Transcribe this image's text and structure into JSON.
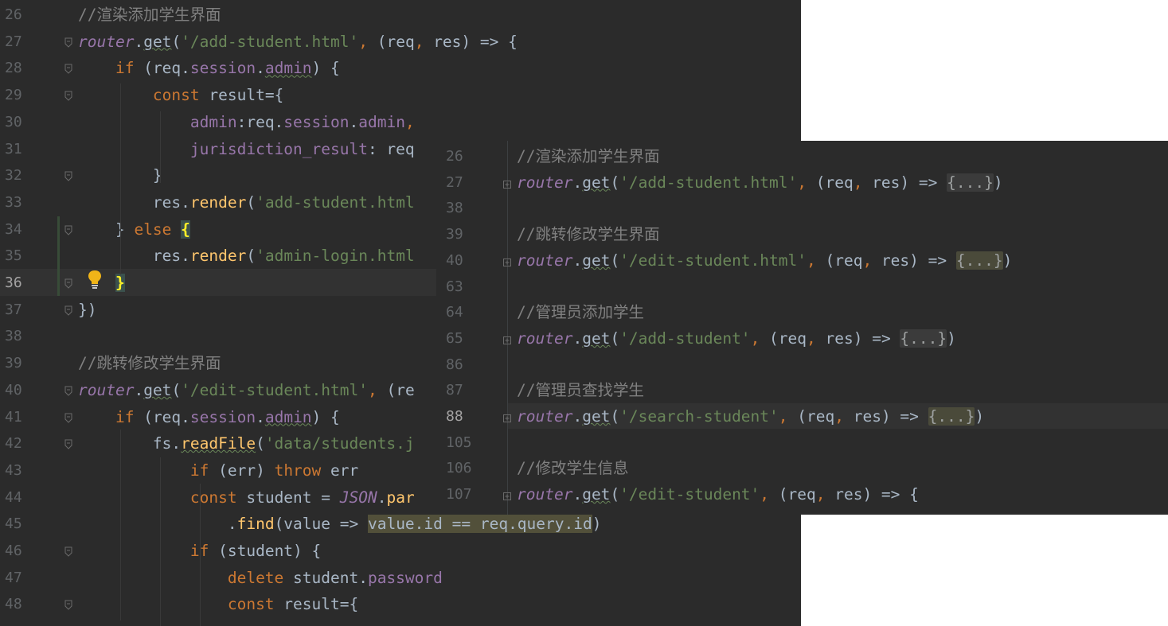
{
  "editor_main": {
    "line_numbers": [
      "26",
      "27",
      "28",
      "29",
      "30",
      "31",
      "32",
      "33",
      "34",
      "35",
      "36",
      "37",
      "38",
      "39",
      "40",
      "41",
      "42",
      "43",
      "44",
      "45",
      "46",
      "47",
      "48"
    ],
    "current_line": "36",
    "lines": [
      [
        [
          "cn",
          "//渲染添加学生界面"
        ]
      ],
      [
        [
          "obj",
          "router"
        ],
        [
          "",
          "."
        ],
        [
          "fn-w",
          "get"
        ],
        [
          "",
          "("
        ],
        [
          "str",
          "'/add-student.html'"
        ],
        [
          "kw",
          ", "
        ],
        [
          "",
          "(req"
        ],
        [
          "kw",
          ", "
        ],
        [
          "",
          "res) => {"
        ]
      ],
      [
        [
          "",
          "    "
        ],
        [
          "kw",
          "if "
        ],
        [
          "",
          "(req."
        ],
        [
          "prop",
          "session"
        ],
        [
          "",
          "."
        ],
        [
          "prop-w",
          "admin"
        ],
        [
          "",
          ") {"
        ]
      ],
      [
        [
          "",
          "        "
        ],
        [
          "kw",
          "const "
        ],
        [
          "",
          "result={"
        ]
      ],
      [
        [
          "",
          "            "
        ],
        [
          "prop",
          "admin"
        ],
        [
          "",
          ":req."
        ],
        [
          "prop",
          "session"
        ],
        [
          "",
          "."
        ],
        [
          "prop",
          "admin"
        ],
        [
          "kw",
          ","
        ]
      ],
      [
        [
          "",
          "            "
        ],
        [
          "prop",
          "jurisdiction_result"
        ],
        [
          "",
          ": req"
        ]
      ],
      [
        [
          "",
          "        }"
        ]
      ],
      [
        [
          "",
          "        res."
        ],
        [
          "fn",
          "render"
        ],
        [
          "",
          "("
        ],
        [
          "str",
          "'add-student.html"
        ]
      ],
      [
        [
          "",
          "    } "
        ],
        [
          "kw",
          "else "
        ],
        [
          "bh",
          "{"
        ]
      ],
      [
        [
          "",
          "        res."
        ],
        [
          "fn",
          "render"
        ],
        [
          "",
          "("
        ],
        [
          "str",
          "'admin-login.html"
        ]
      ],
      [
        [
          "",
          "    "
        ],
        [
          "bh",
          "}"
        ]
      ],
      [
        [
          "",
          "})"
        ]
      ],
      [],
      [
        [
          "cn",
          "//跳转修改学生界面"
        ]
      ],
      [
        [
          "obj",
          "router"
        ],
        [
          "",
          "."
        ],
        [
          "fn-w",
          "get"
        ],
        [
          "",
          "("
        ],
        [
          "str",
          "'/edit-student.html'"
        ],
        [
          "kw",
          ", "
        ],
        [
          "",
          "(re"
        ]
      ],
      [
        [
          "",
          "    "
        ],
        [
          "kw",
          "if "
        ],
        [
          "",
          "(req."
        ],
        [
          "prop",
          "session"
        ],
        [
          "",
          "."
        ],
        [
          "prop-w",
          "admin"
        ],
        [
          "",
          ") {"
        ]
      ],
      [
        [
          "",
          "        fs."
        ],
        [
          "fn-u",
          "readFile"
        ],
        [
          "",
          "("
        ],
        [
          "str",
          "'data/students.j"
        ]
      ],
      [
        [
          "",
          "            "
        ],
        [
          "kw",
          "if "
        ],
        [
          "",
          "(err) "
        ],
        [
          "kw",
          "throw "
        ],
        [
          "",
          "err"
        ]
      ],
      [
        [
          "",
          "            "
        ],
        [
          "kw",
          "const "
        ],
        [
          "",
          "student = "
        ],
        [
          "it",
          "JSON"
        ],
        [
          "",
          "."
        ],
        [
          "fn",
          "par"
        ]
      ],
      [
        [
          "",
          "                ."
        ],
        [
          "fn",
          "find"
        ],
        [
          "",
          "(value => "
        ],
        [
          "sel",
          "value.id == req.query.id"
        ],
        [
          "",
          ")"
        ]
      ],
      [
        [
          "",
          "            "
        ],
        [
          "kw",
          "if "
        ],
        [
          "",
          "(student) {"
        ]
      ],
      [
        [
          "",
          "                "
        ],
        [
          "kw",
          "delete "
        ],
        [
          "",
          "student."
        ],
        [
          "prop",
          "password"
        ]
      ],
      [
        [
          "",
          "                "
        ],
        [
          "kw",
          "const "
        ],
        [
          "",
          "result={"
        ]
      ]
    ]
  },
  "editor_popup": {
    "line_numbers": [
      "26",
      "27",
      "38",
      "39",
      "40",
      "63",
      "64",
      "65",
      "86",
      "87",
      "88",
      "105",
      "106",
      "107"
    ],
    "current_line": "88",
    "lines": [
      [
        [
          "cn",
          "//渲染添加学生界面"
        ]
      ],
      [
        [
          "obj",
          "router"
        ],
        [
          "",
          "."
        ],
        [
          "fn-w",
          "get"
        ],
        [
          "",
          "("
        ],
        [
          "str",
          "'/add-student.html'"
        ],
        [
          "kw",
          ", "
        ],
        [
          "",
          "(req"
        ],
        [
          "kw",
          ", "
        ],
        [
          "",
          "res) => "
        ],
        [
          "fc",
          "{...}"
        ],
        [
          "",
          ")"
        ]
      ],
      [],
      [
        [
          "cn",
          "//跳转修改学生界面"
        ]
      ],
      [
        [
          "obj",
          "router"
        ],
        [
          "",
          "."
        ],
        [
          "fn-w",
          "get"
        ],
        [
          "",
          "("
        ],
        [
          "str",
          "'/edit-student.html'"
        ],
        [
          "kw",
          ", "
        ],
        [
          "",
          "(req"
        ],
        [
          "kw",
          ", "
        ],
        [
          "",
          "res) => "
        ],
        [
          "fch",
          "{...}"
        ],
        [
          "",
          ")"
        ]
      ],
      [],
      [
        [
          "cn",
          "//管理员添加学生"
        ]
      ],
      [
        [
          "obj",
          "router"
        ],
        [
          "",
          "."
        ],
        [
          "fn-w",
          "get"
        ],
        [
          "",
          "("
        ],
        [
          "str",
          "'/add-student'"
        ],
        [
          "kw",
          ", "
        ],
        [
          "",
          "(req"
        ],
        [
          "kw",
          ", "
        ],
        [
          "",
          "res) => "
        ],
        [
          "fc",
          "{...}"
        ],
        [
          "",
          ")"
        ]
      ],
      [],
      [
        [
          "cn",
          "//管理员查找学生"
        ]
      ],
      [
        [
          "obj",
          "router"
        ],
        [
          "",
          "."
        ],
        [
          "fn-w",
          "get"
        ],
        [
          "",
          "("
        ],
        [
          "str",
          "'/search-student'"
        ],
        [
          "kw",
          ", "
        ],
        [
          "",
          "(req"
        ],
        [
          "kw",
          ", "
        ],
        [
          "",
          "res) => "
        ],
        [
          "fch",
          "{...}"
        ],
        [
          "",
          ")"
        ]
      ],
      [],
      [
        [
          "cn",
          "//修改学生信息"
        ]
      ],
      [
        [
          "obj",
          "router"
        ],
        [
          "",
          "."
        ],
        [
          "fn-w",
          "get"
        ],
        [
          "",
          "("
        ],
        [
          "str",
          "'/edit-student'"
        ],
        [
          "kw",
          ", "
        ],
        [
          "",
          "(req"
        ],
        [
          "kw",
          ", "
        ],
        [
          "",
          "res) => {"
        ]
      ]
    ]
  },
  "colors": {
    "background": "#2b2b2b",
    "keyword": "#cc7832",
    "string": "#6a8759",
    "comment": "#808080",
    "property": "#9876aa",
    "function": "#ffc66d",
    "text": "#a9b7c6"
  },
  "icons": {
    "intention": "lightbulb-icon",
    "fold": "fold-marker-icon"
  }
}
